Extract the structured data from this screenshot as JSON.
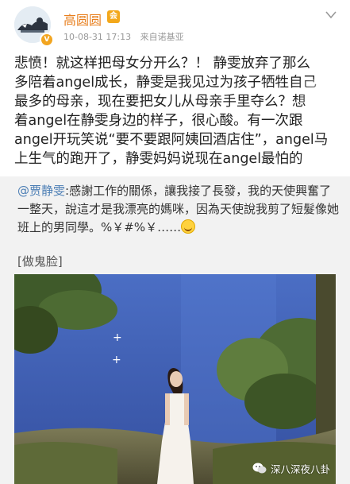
{
  "post": {
    "username": "高圆圆",
    "vip_badge": "会",
    "verified_badge": "V",
    "timestamp": "10-08-31 17:13",
    "source": "来自诺基亚",
    "text_lines": [
      "悲愤！就这样把母女分开么？！ 静雯放弃了那么",
      "多陪着angel成长，静雯是我见过为孩子牺牲自己",
      "最多的母亲，现在要把女儿从母亲手里夺么？想",
      "着angel在静雯身边的样子，很心酸。有一次跟",
      "angel开玩笑说“要不要跟阿姨回酒店住”，angel马",
      "上生气的跑开了，静雯妈妈说现在angel最怕的"
    ]
  },
  "repost": {
    "mention": "@贾静雯",
    "text": ":感謝工作的關係，讓我接了長發，我的天使興奮了一整天，說這才是我漂亮的媽咪，因為天使說我剪了短髮像她班上的男同學。%￥#%￥……",
    "tag": "[做鬼脸]"
  },
  "watermark": "深八深夜八卦",
  "icons": {
    "chevron": "chevron-down-icon",
    "smile": "grin-emoji-icon",
    "wechat": "wechat-icon"
  },
  "colors": {
    "username": "#e87f1e",
    "mention": "#4d7fb5",
    "repost_bg": "#f2f2f2"
  }
}
